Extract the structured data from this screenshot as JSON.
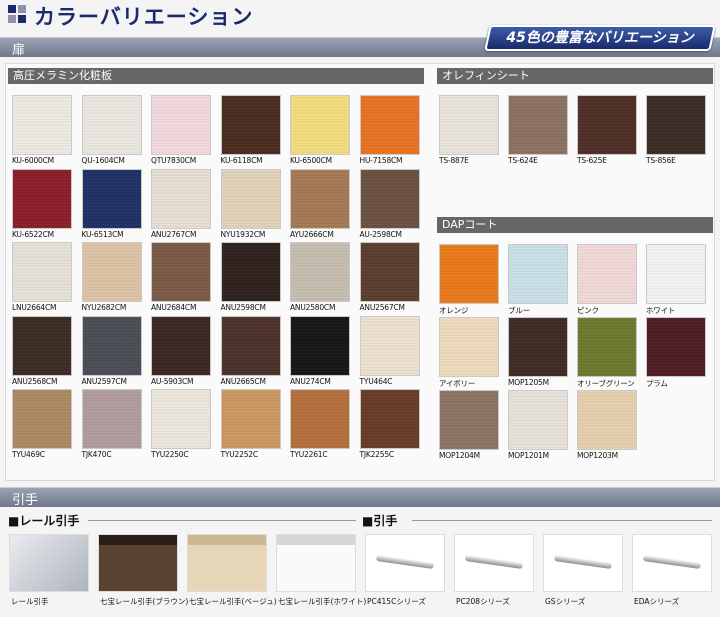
{
  "title": "カラーバリエーション",
  "sections": {
    "door": "扉",
    "handle": "引手"
  },
  "badge": "45色の豊富なバリエーション",
  "groups": {
    "melamine": "高圧メラミン化粧板",
    "olefin": "オレフィンシート",
    "dap": "DAPコート"
  },
  "melamine_swatches": [
    {
      "code": "KU-6000CM",
      "color": "#f2efe7"
    },
    {
      "code": "QU-1604CM",
      "color": "#efece4"
    },
    {
      "code": "QTU7830CM",
      "color": "#f7dde2"
    },
    {
      "code": "KU-6118CM",
      "color": "#4a2a1f"
    },
    {
      "code": "KU-6500CM",
      "color": "#f7e27f"
    },
    {
      "code": "HU-7158CM",
      "color": "#ee7421"
    },
    {
      "code": "KU-6522CM",
      "color": "#8c1d26"
    },
    {
      "code": "KU-6513CM",
      "color": "#1c2f66"
    },
    {
      "code": "ANU2767CM",
      "color": "#ebe3d6"
    },
    {
      "code": "NYU1932CM",
      "color": "#e6d7bd"
    },
    {
      "code": "AYU2666CM",
      "color": "#a67a52"
    },
    {
      "code": "AU-2598CM",
      "color": "#6b5040"
    },
    {
      "code": "LNU2664CM",
      "color": "#ece6dd"
    },
    {
      "code": "NYU2682CM",
      "color": "#e0c7a6"
    },
    {
      "code": "ANU2684CM",
      "color": "#7a5a46"
    },
    {
      "code": "ANU2598CM",
      "color": "#2e1f1b"
    },
    {
      "code": "ANU2580CM",
      "color": "#c9c1b2"
    },
    {
      "code": "ANU2567CM",
      "color": "#5a3c2e"
    },
    {
      "code": "ANU2568CM",
      "color": "#3b2a22"
    },
    {
      "code": "ANU2597CM",
      "color": "#4a4d54"
    },
    {
      "code": "AU-5903CM",
      "color": "#3a2420"
    },
    {
      "code": "ANU2665CM",
      "color": "#4b3028"
    },
    {
      "code": "ANU274CM",
      "color": "#141414"
    },
    {
      "code": "TYU464C",
      "color": "#f2e6d3"
    },
    {
      "code": "TYU469C",
      "color": "#b08a62"
    },
    {
      "code": "TJK470C",
      "color": "#b49fa0"
    },
    {
      "code": "TYU2250C",
      "color": "#f1ebe1"
    },
    {
      "code": "TYU2252C",
      "color": "#cf9a63"
    },
    {
      "code": "TYU2261C",
      "color": "#b9703d"
    },
    {
      "code": "TJK2255C",
      "color": "#6a3b27"
    }
  ],
  "olefin_swatches": [
    {
      "code": "TS-887E",
      "color": "#efe9e0"
    },
    {
      "code": "TS-624E",
      "color": "#8e7262"
    },
    {
      "code": "TS-625E",
      "color": "#4e2e25"
    },
    {
      "code": "TS-856E",
      "color": "#3a2b24"
    }
  ],
  "dap_swatches": [
    {
      "code": "オレンジ",
      "color": "#ee7a18"
    },
    {
      "code": "ブルー",
      "color": "#cde5ec"
    },
    {
      "code": "ピンク",
      "color": "#f5dddb"
    },
    {
      "code": "ホワイト",
      "color": "#f8f8f6"
    },
    {
      "code": "アイボリー",
      "color": "#f3dfc0"
    },
    {
      "code": "MOP1205M",
      "color": "#3e2a23"
    },
    {
      "code": "オリーブグリーン",
      "color": "#6d7a2b"
    },
    {
      "code": "プラム",
      "color": "#4e1a22"
    },
    {
      "code": "MOP1204M",
      "color": "#8e7464"
    },
    {
      "code": "MOP1201M",
      "color": "#ece6de"
    },
    {
      "code": "MOP1203M",
      "color": "#ead4b0"
    }
  ],
  "handles": {
    "rail_heading": "■レール引手",
    "pull_heading": "■引手",
    "items": [
      {
        "label": "レール引手",
        "kind": "rail-silver"
      },
      {
        "label": "七宝レール引手(ブラウン)",
        "kind": "rail-brown"
      },
      {
        "label": "七宝レール引手(ベージュ)",
        "kind": "rail-beige"
      },
      {
        "label": "七宝レール引手(ホワイト)",
        "kind": "rail-white"
      },
      {
        "label": "PC415Cシリーズ",
        "kind": "pull"
      },
      {
        "label": "PC208シリーズ",
        "kind": "pull"
      },
      {
        "label": "GSシリーズ",
        "kind": "pull"
      },
      {
        "label": "EDAシリーズ",
        "kind": "pull"
      }
    ]
  }
}
